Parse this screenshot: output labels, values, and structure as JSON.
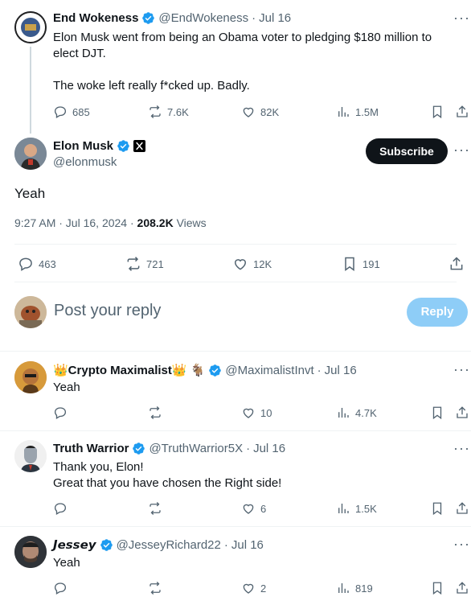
{
  "original_tweet": {
    "display_name": "End Wokeness",
    "handle": "@EndWokeness",
    "date": "Jul 16",
    "text": "Elon Musk went from being an Obama voter to pledging $180 million to elect DJT.\n\nThe woke left really f*cked up. Badly.",
    "replies": "685",
    "reposts": "7.6K",
    "likes": "82K",
    "views": "1.5M"
  },
  "main_tweet": {
    "display_name": "Elon Musk",
    "handle": "@elonmusk",
    "subscribe_label": "Subscribe",
    "text": "Yeah",
    "time": "9:27 AM · Jul 16, 2024 · ",
    "views_count": "208.2K",
    "views_label": " Views",
    "replies": "463",
    "reposts": "721",
    "likes": "12K",
    "bookmarks": "191"
  },
  "composer": {
    "placeholder": "Post your reply",
    "reply_label": "Reply"
  },
  "replies": [
    {
      "display_name": "👑Crypto Maximalist👑 🐐",
      "handle": "@MaximalistInvt",
      "date": "Jul 16",
      "text": "Yeah",
      "replies": "",
      "reposts": "",
      "likes": "10",
      "views": "4.7K"
    },
    {
      "display_name": "Truth Warrior",
      "handle": "@TruthWarrior5X",
      "date": "Jul 16",
      "text": "Thank you, Elon!\nGreat that you have chosen the Right side!",
      "replies": "",
      "reposts": "",
      "likes": "6",
      "views": "1.5K"
    },
    {
      "display_name": "𝙅𝙚𝙨𝙨𝙚𝙮",
      "handle": "@JesseyRichard22",
      "date": "Jul 16",
      "text": "Yeah",
      "replies": "",
      "reposts": "",
      "likes": "2",
      "views": "819"
    }
  ],
  "colors": {
    "verified": "#1d9bf0",
    "reply_button": "#8ecdf7",
    "subscribe_button": "#0f1419",
    "muted": "#536471"
  }
}
